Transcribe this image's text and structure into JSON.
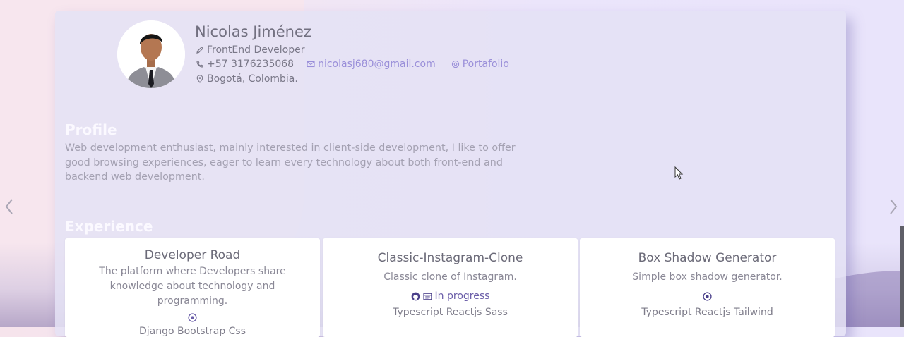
{
  "profile": {
    "name": "Nicolas Jiménez",
    "role": "FrontEnd Developer",
    "phone": "+57 3176235068",
    "email": "nicolasj680@gmail.com",
    "portfolio": "Portafolio",
    "location": "Bogotá, Colombia."
  },
  "sections": {
    "profile_title": "Profile",
    "profile_text": "Web development enthusiast, mainly interested in client-side development, I like to offer good browsing experiences, eager to learn every technology about both front-end and backend web development.",
    "experience_title": "Experience"
  },
  "projects": [
    {
      "title": "Developer Road",
      "description": "The platform where Developers share knowledge about technology and programming.",
      "status": "",
      "tags": "Django Bootstrap Css"
    },
    {
      "title": "Classic-Instagram-Clone",
      "description": "Classic clone of Instagram.",
      "status": "In progress",
      "tags": "Typescript Reactjs Sass"
    },
    {
      "title": "Box Shadow Generator",
      "description": "Simple box shadow generator.",
      "status": "",
      "tags": "Typescript Reactjs Tailwind"
    }
  ],
  "icons": {
    "role": "pencil-icon",
    "phone": "phone-icon",
    "email": "mail-icon",
    "portfolio": "at-icon",
    "location": "location-pin-icon",
    "github": "github-icon",
    "demo": "browser-icon",
    "prev": "chevron-left-icon",
    "next": "chevron-right-icon"
  },
  "colors": {
    "accent": "#9a8fd9",
    "section_title": "#fbf9ff",
    "card_bg": "#e4e2f5"
  }
}
